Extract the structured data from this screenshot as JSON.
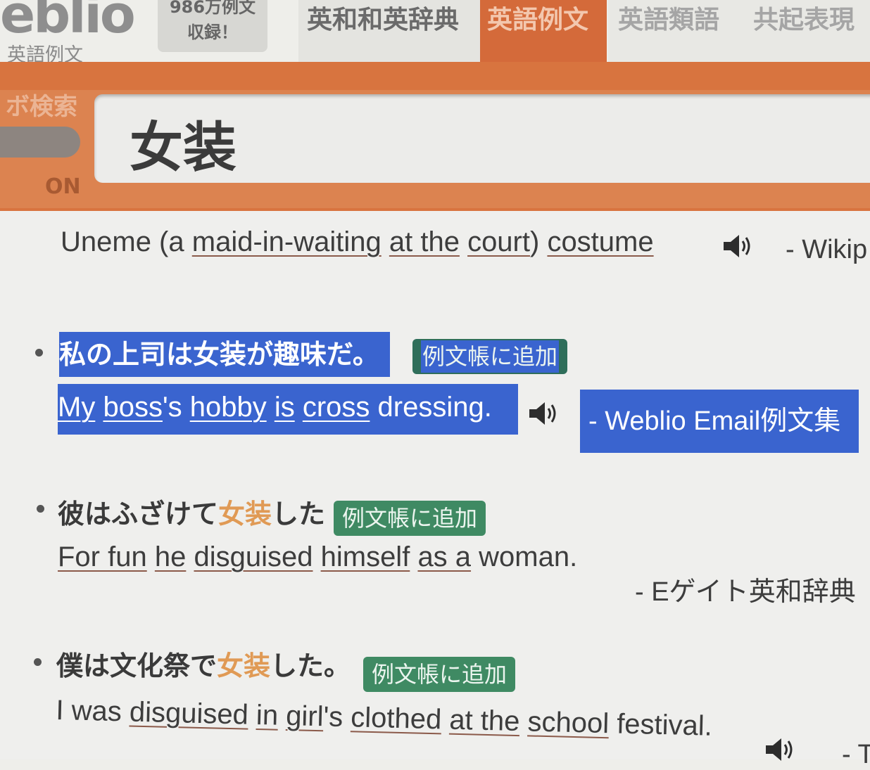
{
  "header": {
    "logo_text": "eblio",
    "logo_subtitle": "英語例文",
    "count_line1": "986万例文",
    "count_line2": "収録！",
    "tabs": [
      {
        "label": "英和和英辞典"
      },
      {
        "label": "英語例文"
      },
      {
        "label": "英語類語"
      },
      {
        "label": "共起表現"
      }
    ],
    "robo_label": "ボ検索",
    "toggle_state": "ON",
    "search_value": "女装"
  },
  "results": {
    "first_line": {
      "parts": [
        "Uneme (a ",
        "maid-in-waiting",
        " ",
        "at the",
        " ",
        "court",
        ") ",
        "costume"
      ],
      "source": "- Wikip"
    },
    "items": [
      {
        "jp": "私の上司は女装が趣味だ。",
        "add_label": "例文帳に追加",
        "en_parts": [
          "My",
          " ",
          "boss",
          "'s ",
          "hobby",
          " ",
          "is",
          " ",
          "cross",
          " dressing."
        ],
        "source": "- Weblio Email例文集"
      },
      {
        "jp_before": "彼はふざけて",
        "jp_hl": "女装",
        "jp_after": "した",
        "add_label": "例文帳に追加",
        "en_parts": [
          "For fun",
          " ",
          "he",
          " ",
          "disguised",
          " ",
          "himself",
          " ",
          "as a",
          " woman."
        ],
        "source": "- Eゲイト英和辞典"
      },
      {
        "jp_before": "僕は文化祭で",
        "jp_hl": "女装",
        "jp_after": "した。",
        "add_label": "例文帳に追加",
        "en_parts": [
          "I was ",
          "disguised",
          " ",
          "in",
          " ",
          "girl",
          "'s ",
          "clothed",
          " ",
          "at the",
          " ",
          "school",
          " festival."
        ],
        "source": "- To"
      }
    ]
  },
  "colors": {
    "accent_orange": "#d8743f",
    "selection_blue": "#3a64cf",
    "add_button_green": "#3f8a63",
    "keyword_highlight": "#e09a55"
  },
  "icons": {
    "speaker": "speaker-icon"
  }
}
